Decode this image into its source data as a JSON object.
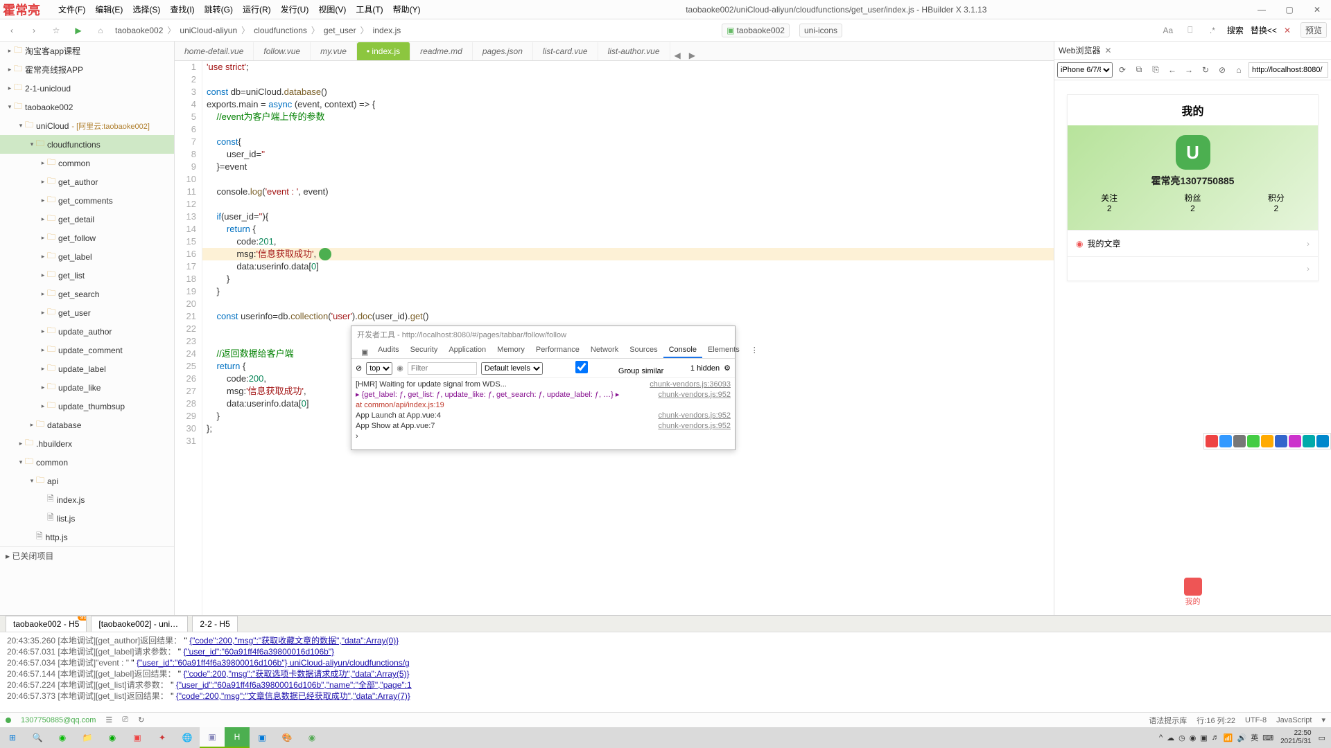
{
  "titlebar": {
    "logo_text": "霍常亮",
    "menus": [
      "文件(F)",
      "编辑(E)",
      "选择(S)",
      "查找(I)",
      "跳转(G)",
      "运行(R)",
      "发行(U)",
      "视图(V)",
      "工具(T)",
      "帮助(Y)"
    ],
    "title": "taobaoke002/uniCloud-aliyun/cloudfunctions/get_user/index.js - HBuilder X 3.1.13"
  },
  "toolbar": {
    "breadcrumb": [
      "taobaoke002",
      "uniCloud-aliyun",
      "cloudfunctions",
      "get_user",
      "index.js"
    ],
    "link1": "taobaoke002",
    "link2": "uni-icons",
    "search": "搜索",
    "replace": "替换<<",
    "preview": "预览"
  },
  "sidebar": {
    "items": [
      {
        "indent": 0,
        "chev": "▸",
        "icon": "folder",
        "label": "淘宝客app课程"
      },
      {
        "indent": 0,
        "chev": "▸",
        "icon": "folder",
        "label": "霍常亮线报APP"
      },
      {
        "indent": 0,
        "chev": "▸",
        "icon": "folder",
        "label": "2-1-unicloud"
      },
      {
        "indent": 0,
        "chev": "▾",
        "icon": "folder",
        "label": "taobaoke002"
      },
      {
        "indent": 1,
        "chev": "▾",
        "icon": "folder",
        "label": "uniCloud",
        "anno": "- [阿里云:taobaoke002]"
      },
      {
        "indent": 2,
        "chev": "▾",
        "icon": "folder",
        "label": "cloudfunctions",
        "sel": true
      },
      {
        "indent": 3,
        "chev": "▸",
        "icon": "folder",
        "label": "common"
      },
      {
        "indent": 3,
        "chev": "▸",
        "icon": "folder",
        "label": "get_author"
      },
      {
        "indent": 3,
        "chev": "▸",
        "icon": "folder",
        "label": "get_comments"
      },
      {
        "indent": 3,
        "chev": "▸",
        "icon": "folder",
        "label": "get_detail"
      },
      {
        "indent": 3,
        "chev": "▸",
        "icon": "folder",
        "label": "get_follow"
      },
      {
        "indent": 3,
        "chev": "▸",
        "icon": "folder",
        "label": "get_label"
      },
      {
        "indent": 3,
        "chev": "▸",
        "icon": "folder",
        "label": "get_list"
      },
      {
        "indent": 3,
        "chev": "▸",
        "icon": "folder",
        "label": "get_search"
      },
      {
        "indent": 3,
        "chev": "▸",
        "icon": "folder",
        "label": "get_user"
      },
      {
        "indent": 3,
        "chev": "▸",
        "icon": "folder",
        "label": "update_author"
      },
      {
        "indent": 3,
        "chev": "▸",
        "icon": "folder",
        "label": "update_comment"
      },
      {
        "indent": 3,
        "chev": "▸",
        "icon": "folder",
        "label": "update_label"
      },
      {
        "indent": 3,
        "chev": "▸",
        "icon": "folder",
        "label": "update_like"
      },
      {
        "indent": 3,
        "chev": "▸",
        "icon": "folder",
        "label": "update_thumbsup"
      },
      {
        "indent": 2,
        "chev": "▸",
        "icon": "folder",
        "label": "database"
      },
      {
        "indent": 1,
        "chev": "▸",
        "icon": "folder",
        "label": ".hbuilderx"
      },
      {
        "indent": 1,
        "chev": "▾",
        "icon": "folder",
        "label": "common"
      },
      {
        "indent": 2,
        "chev": "▾",
        "icon": "folder",
        "label": "api"
      },
      {
        "indent": 3,
        "chev": "",
        "icon": "file",
        "label": "index.js"
      },
      {
        "indent": 3,
        "chev": "",
        "icon": "file",
        "label": "list.js"
      },
      {
        "indent": 2,
        "chev": "",
        "icon": "file",
        "label": "http.js"
      }
    ],
    "siblings_header": "已关闭项目"
  },
  "tabs": {
    "items": [
      {
        "label": "home-detail.vue"
      },
      {
        "label": "follow.vue"
      },
      {
        "label": "my.vue"
      },
      {
        "label": "• index.js",
        "active": true
      },
      {
        "label": "readme.md"
      },
      {
        "label": "pages.json"
      },
      {
        "label": "list-card.vue"
      },
      {
        "label": "list-author.vue"
      }
    ]
  },
  "code": {
    "lines": [
      {
        "n": 1,
        "html": "<span class='str'>'use strict'</span>;"
      },
      {
        "n": 2,
        "html": ""
      },
      {
        "n": 3,
        "html": "<span class='kw'>const</span> db=uniCloud.<span class='fn'>database</span>()"
      },
      {
        "n": 4,
        "html": "exports.main = <span class='kw'>async</span> (event, context) =&gt; {"
      },
      {
        "n": 5,
        "html": "    <span class='cm'>//event为客户端上传的参数</span>"
      },
      {
        "n": 6,
        "html": ""
      },
      {
        "n": 7,
        "html": "    <span class='kw'>const</span>{"
      },
      {
        "n": 8,
        "html": "        user_id=<span class='str'>''</span>"
      },
      {
        "n": 9,
        "html": "    }=event"
      },
      {
        "n": 10,
        "html": ""
      },
      {
        "n": 11,
        "html": "    console.<span class='fn'>log</span>(<span class='str'>'event : '</span>, event)"
      },
      {
        "n": 12,
        "html": ""
      },
      {
        "n": 13,
        "html": "    <span class='kw'>if</span>(user_id=<span class='str'>''</span>){"
      },
      {
        "n": 14,
        "html": "        <span class='kw'>return</span> {"
      },
      {
        "n": 15,
        "html": "            code:<span class='num'>201</span>,"
      },
      {
        "n": 16,
        "html": "            msg:<span class='str'>'信息获取成功'</span>,",
        "hl": true,
        "badge": 168
      },
      {
        "n": 17,
        "html": "            data:userinfo.data[<span class='num'>0</span>]"
      },
      {
        "n": 18,
        "html": "        }"
      },
      {
        "n": 19,
        "html": "    }"
      },
      {
        "n": 20,
        "html": ""
      },
      {
        "n": 21,
        "html": "    <span class='kw'>const</span> userinfo=db.<span class='fn'>collection</span>(<span class='str'>'user'</span>).<span class='fn'>doc</span>(user_id).<span class='fn'>get</span>()"
      },
      {
        "n": 22,
        "html": ""
      },
      {
        "n": 23,
        "html": ""
      },
      {
        "n": 24,
        "html": "    <span class='cm'>//返回数据给客户端</span>"
      },
      {
        "n": 25,
        "html": "    <span class='kw'>return</span> {"
      },
      {
        "n": 26,
        "html": "        code:<span class='num'>200</span>,"
      },
      {
        "n": 27,
        "html": "        msg:<span class='str'>'信息获取成功'</span>,"
      },
      {
        "n": 28,
        "html": "        data:userinfo.data[<span class='num'>0</span>]"
      },
      {
        "n": 29,
        "html": "    }"
      },
      {
        "n": 30,
        "html": "};"
      },
      {
        "n": 31,
        "html": ""
      }
    ]
  },
  "preview": {
    "title": "Web浏览器",
    "device": "iPhone 6/7/8",
    "url": "http://localhost:8080/",
    "page_title": "我的",
    "username": "霍常亮1307750885",
    "stats": [
      {
        "label": "关注",
        "value": "2"
      },
      {
        "label": "粉丝",
        "value": "2"
      },
      {
        "label": "积分",
        "value": "2"
      }
    ],
    "row1": "我的文章",
    "nav_label": "我的"
  },
  "devtools": {
    "title": "开发者工具 - http://localhost:8080/#/pages/tabbar/follow/follow",
    "tabs": [
      "Elements",
      "Console",
      "Sources",
      "Network",
      "Performance",
      "Memory",
      "Application",
      "Security",
      "Audits"
    ],
    "active_tab": "Console",
    "filter_placeholder": "Filter",
    "top": "top",
    "levels": "Default levels",
    "hidden": "1 hidden",
    "group": "Group similar",
    "lines": [
      {
        "msg": "[HMR] Waiting for update signal from WDS...",
        "src": "chunk-vendors.js:36093"
      },
      {
        "msg": "▸ {get_label: ƒ, get_list: ƒ, update_like: ƒ, get_search: ƒ, update_label: ƒ, …} ▸",
        "src": "chunk-vendors.js:952",
        "obj": true
      },
      {
        "msg": "   at common/api/index.js:19",
        "err": true
      },
      {
        "msg": "App Launch  at App.vue:4",
        "src": "chunk-vendors.js:952"
      },
      {
        "msg": "App Show  at App.vue:7",
        "src": "chunk-vendors.js:952"
      },
      {
        "msg": "›"
      }
    ]
  },
  "bottom_tabs": [
    {
      "label": "taobaoke002 - H5",
      "badge": "99"
    },
    {
      "label": "[taobaoke002] - uniClo..."
    },
    {
      "label": "2-2 - H5"
    }
  ],
  "console": [
    {
      "ts": "20:43:35.260",
      "tag": "[本地调试][get_author]返回结果：",
      "json": "{\"code\":200,\"msg\":\"获取收藏文章的数据\",\"data\":Array(0)}"
    },
    {
      "ts": "20:46:57.031",
      "tag": "[本地调试][get_label]请求参数：",
      "json": "{\"user_id\":\"60a91ff4f6a39800016d106b\"}"
    },
    {
      "ts": "20:46:57.034",
      "tag": "[本地调试]\"event :  \"",
      "json": "{\"user_id\":\"60a91ff4f6a39800016d106b\"} uniCloud-aliyun/cloudfunctions/g"
    },
    {
      "ts": "20:46:57.144",
      "tag": "[本地调试][get_label]返回结果：",
      "json": "{\"code\":200,\"msg\":\"获取选项卡数据请求成功\",\"data\":Array(5)}"
    },
    {
      "ts": "20:46:57.224",
      "tag": "[本地调试][get_list]请求参数：",
      "json": "{\"user_id\":\"60a91ff4f6a39800016d106b\",\"name\":\"全部\",\"page\":1"
    },
    {
      "ts": "20:46:57.373",
      "tag": "[本地调试][get_list]返回结果：",
      "json": "{\"code\":200,\"msg\":\"文章信息数据已经获取成功\",\"data\":Array(7)}"
    }
  ],
  "statusbar": {
    "user": "1307750885@qq.com",
    "hint": "语法提示库",
    "pos": "行:16  列:22",
    "enc": "UTF-8",
    "lang": "JavaScript"
  },
  "taskbar": {
    "time": "22:50",
    "date": "2021/5/31",
    "ime": "英"
  }
}
